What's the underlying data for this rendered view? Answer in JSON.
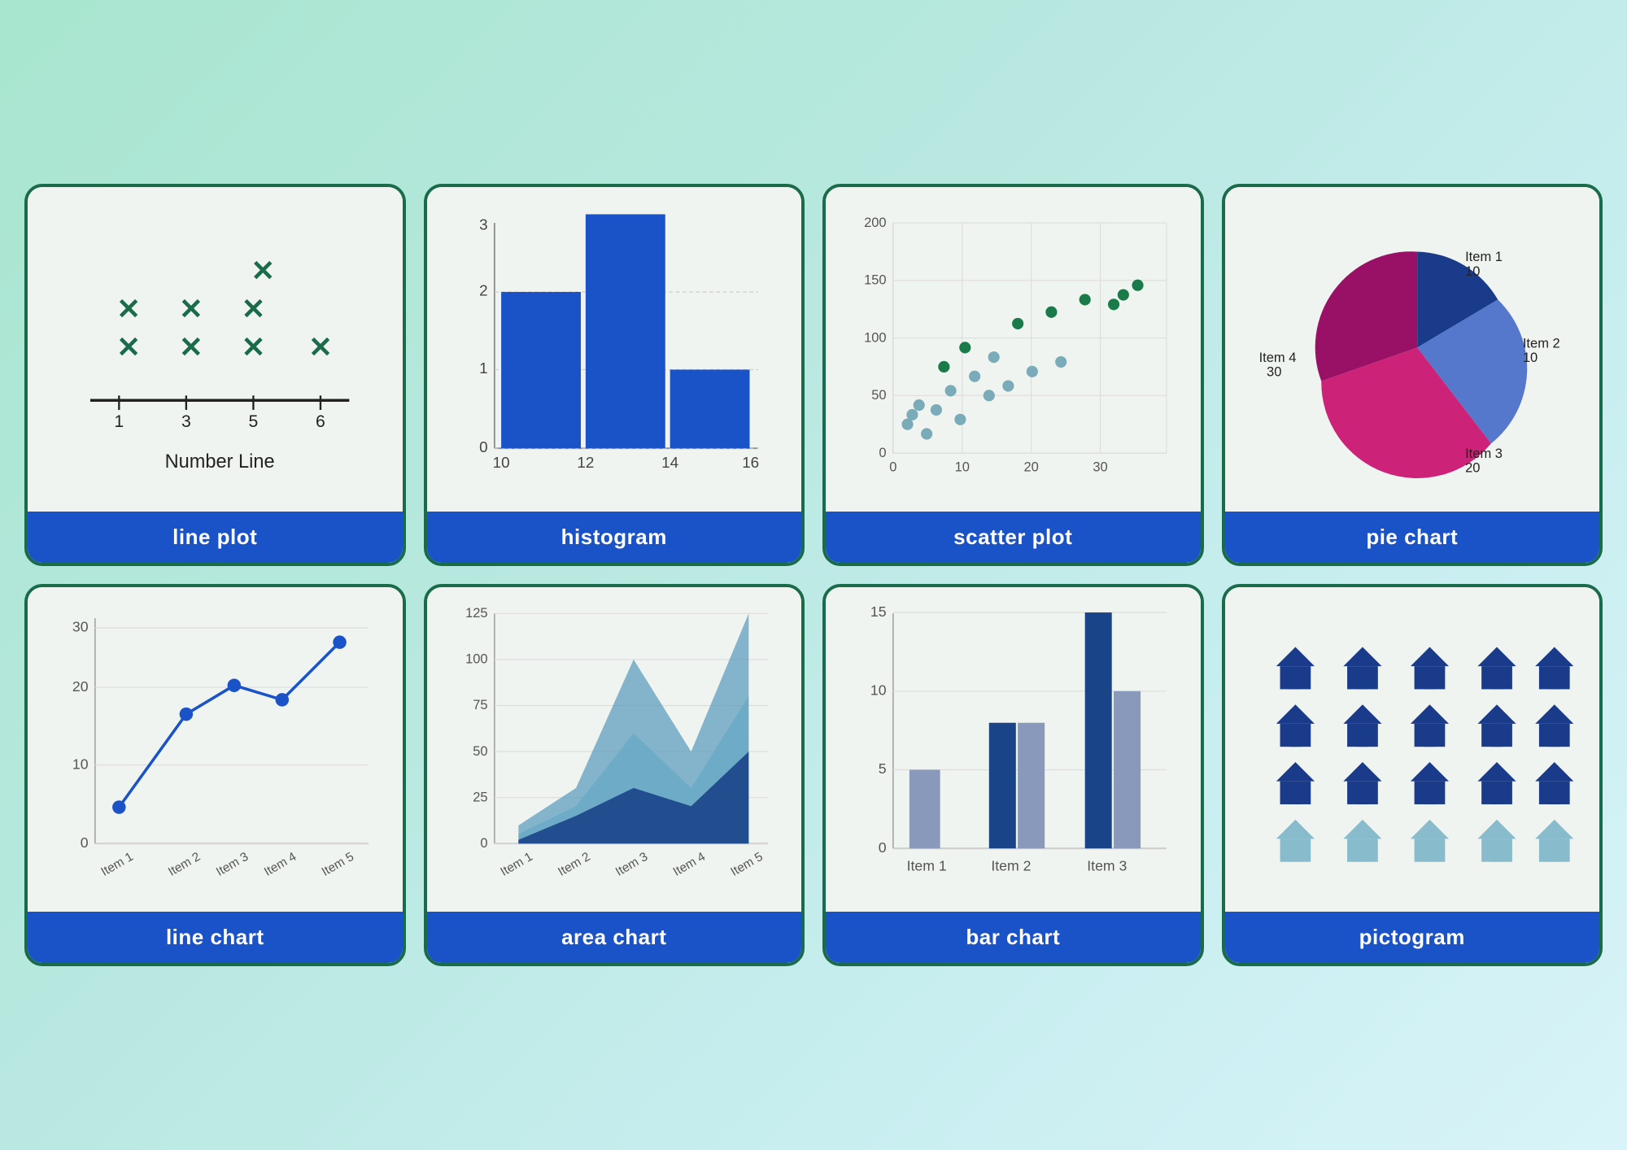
{
  "cards": [
    {
      "id": "line-plot",
      "label": "line plot",
      "type": "line-plot"
    },
    {
      "id": "histogram",
      "label": "histogram",
      "type": "histogram"
    },
    {
      "id": "scatter-plot",
      "label": "scatter plot",
      "type": "scatter-plot"
    },
    {
      "id": "pie-chart",
      "label": "pie chart",
      "type": "pie-chart"
    },
    {
      "id": "line-chart",
      "label": "line chart",
      "type": "line-chart"
    },
    {
      "id": "area-chart",
      "label": "area chart",
      "type": "area-chart"
    },
    {
      "id": "bar-chart",
      "label": "bar chart",
      "type": "bar-chart"
    },
    {
      "id": "pictogram",
      "label": "pictogram",
      "type": "pictogram"
    }
  ],
  "colors": {
    "dark_green": "#1a6b4a",
    "blue": "#1a52c8",
    "light_blue": "#1a52c8",
    "mid_blue": "#2255bb",
    "teal": "#5599bb",
    "light_teal": "#88bbcc",
    "purple": "#883388",
    "magenta": "#bb2277",
    "gray_blue": "#8899bb"
  }
}
